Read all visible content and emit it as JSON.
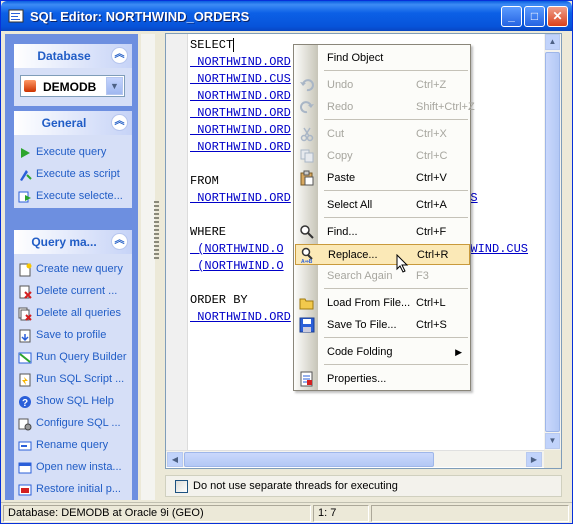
{
  "window": {
    "title": "SQL Editor: NORTHWIND_ORDERS"
  },
  "database_group": {
    "title": "Database",
    "selected_db": "DEMODB"
  },
  "general_group": {
    "title": "General",
    "items": [
      {
        "label": "Execute query",
        "icon": "play-icon"
      },
      {
        "label": "Execute as script",
        "icon": "script-icon"
      },
      {
        "label": "Execute selecte...",
        "icon": "execute-selected-icon"
      }
    ]
  },
  "query_group": {
    "title": "Query ma...",
    "items": [
      {
        "label": "Create new query",
        "icon": "new-query-icon"
      },
      {
        "label": "Delete current ...",
        "icon": "delete-query-icon"
      },
      {
        "label": "Delete all queries",
        "icon": "delete-all-icon"
      },
      {
        "label": "Save to profile",
        "icon": "save-profile-icon"
      },
      {
        "label": "Run Query Builder",
        "icon": "query-builder-icon"
      },
      {
        "label": "Run SQL Script ...",
        "icon": "sql-script-icon"
      },
      {
        "label": "Show SQL Help",
        "icon": "help-icon"
      },
      {
        "label": "Configure SQL ...",
        "icon": "configure-icon"
      },
      {
        "label": "Rename query",
        "icon": "rename-icon"
      },
      {
        "label": "Open new insta...",
        "icon": "new-instance-icon"
      },
      {
        "label": "Restore initial p...",
        "icon": "restore-icon"
      }
    ]
  },
  "editor": {
    "lines": [
      {
        "kw": "SELECT",
        "ids": ""
      },
      {
        "kw": "",
        "ids": " NORTHWIND.ORD"
      },
      {
        "kw": "",
        "ids": " NORTHWIND.CUS"
      },
      {
        "kw": "",
        "ids": " NORTHWIND.ORD"
      },
      {
        "kw": "",
        "ids": " NORTHWIND.ORD"
      },
      {
        "kw": "",
        "ids": " NORTHWIND.ORD"
      },
      {
        "kw": "",
        "ids": " NORTHWIND.ORD"
      },
      {
        "kw": "",
        "ids": ""
      },
      {
        "kw": "FROM",
        "ids": ""
      },
      {
        "kw": "",
        "ids": " NORTHWIND.ORD"
      },
      {
        "kw": "",
        "ids": ""
      },
      {
        "kw": "WHERE",
        "ids": ""
      },
      {
        "kw": "",
        "ids": " (NORTHWIND.O"
      },
      {
        "kw": "",
        "ids": " (NORTHWIND.O"
      },
      {
        "kw": "",
        "ids": ""
      },
      {
        "kw": "ORDER BY",
        "ids": ""
      },
      {
        "kw": "",
        "ids": " NORTHWIND.ORD"
      }
    ],
    "from_tail": "ERS",
    "where_tail": "THWIND.CUS"
  },
  "checkbox": {
    "label": "Do not use separate threads for executing",
    "checked": false
  },
  "status": {
    "database": "Database: DEMODB  at Oracle 9i (GEO)",
    "position": "1:    7"
  },
  "context_menu": {
    "items": [
      {
        "label": "Find Object",
        "shortcut": "",
        "disabled": false,
        "icon": "",
        "underline": ""
      },
      {
        "label": "Undo",
        "shortcut": "Ctrl+Z",
        "disabled": true,
        "icon": "undo-icon"
      },
      {
        "label": "Redo",
        "shortcut": "Shift+Ctrl+Z",
        "disabled": true,
        "icon": "redo-icon"
      },
      {
        "label": "Cut",
        "shortcut": "Ctrl+X",
        "disabled": true,
        "icon": "cut-icon"
      },
      {
        "label": "Copy",
        "shortcut": "Ctrl+C",
        "disabled": true,
        "icon": "copy-icon"
      },
      {
        "label": "Paste",
        "shortcut": "Ctrl+V",
        "disabled": false,
        "icon": "paste-icon"
      },
      {
        "label": "Select All",
        "shortcut": "Ctrl+A",
        "disabled": false,
        "icon": ""
      },
      {
        "label": "Find...",
        "shortcut": "Ctrl+F",
        "disabled": false,
        "icon": "find-icon"
      },
      {
        "label": "Replace...",
        "shortcut": "Ctrl+R",
        "disabled": false,
        "icon": "replace-icon",
        "highlighted": true
      },
      {
        "label": "Search Again",
        "shortcut": "F3",
        "disabled": true,
        "icon": ""
      },
      {
        "label": "Load From File...",
        "shortcut": "Ctrl+L",
        "disabled": false,
        "icon": "open-folder-icon"
      },
      {
        "label": "Save To File...",
        "shortcut": "Ctrl+S",
        "disabled": false,
        "icon": "save-icon"
      },
      {
        "label": "Code Folding",
        "shortcut": "",
        "disabled": false,
        "icon": "",
        "submenu": true
      },
      {
        "label": "Properties...",
        "shortcut": "",
        "disabled": false,
        "icon": "properties-icon"
      }
    ]
  },
  "colors": {
    "title_bar": "#0a5ee0",
    "panel": "#6d8fe0",
    "link": "#215dc6",
    "highlight": "#fbe9b7"
  }
}
